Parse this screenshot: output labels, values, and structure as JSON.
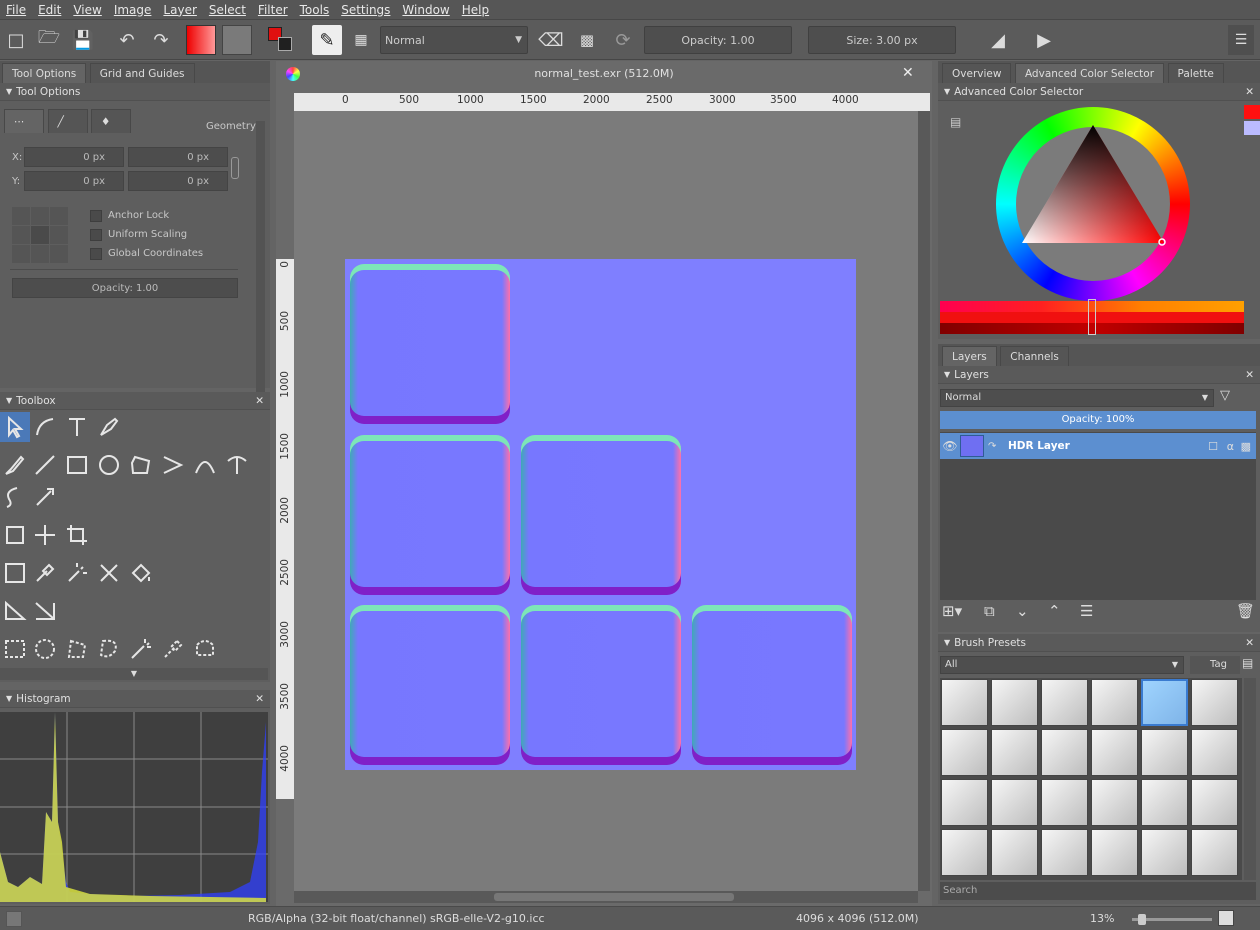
{
  "menu": [
    "File",
    "Edit",
    "View",
    "Image",
    "Layer",
    "Select",
    "Filter",
    "Tools",
    "Settings",
    "Window",
    "Help"
  ],
  "toolbar": {
    "blend_mode": "Normal",
    "opacity_label": "Opacity:",
    "opacity_value": "1.00",
    "size_label": "Size:",
    "size_value": "3.00 px",
    "fg_color": "#e01010",
    "bg_color": "#202020"
  },
  "tool_options_tabs": [
    "Tool Options",
    "Grid and Guides"
  ],
  "tool_options": {
    "title": "Tool Options",
    "geometry_label": "Geometry",
    "x_label": "X:",
    "y_label": "Y:",
    "x_value": "0 px",
    "x2_value": "0 px",
    "y_value": "0 px",
    "y2_value": "0 px",
    "anchor_lock": "Anchor Lock",
    "uniform_scaling": "Uniform Scaling",
    "global_coordinates": "Global Coordinates",
    "opacity": "Opacity: 1.00"
  },
  "toolbox": {
    "title": "Toolbox"
  },
  "histogram": {
    "title": "Histogram"
  },
  "document": {
    "title": "normal_test.exr (512.0M)",
    "ruler_h": [
      "0",
      "500",
      "1000",
      "1500",
      "2000",
      "2500",
      "3000",
      "3500",
      "4000"
    ],
    "ruler_v": [
      "0",
      "500",
      "1000",
      "1500",
      "2000",
      "2500",
      "3000",
      "3500",
      "4000"
    ],
    "canvas_color": "#7f7fff"
  },
  "right_tabs": [
    "Overview",
    "Advanced Color Selector",
    "Palette"
  ],
  "color_selector": {
    "title": "Advanced Color Selector"
  },
  "layer_tabs": [
    "Layers",
    "Channels"
  ],
  "layers": {
    "title": "Layers",
    "blend_mode": "Normal",
    "opacity": "Opacity:  100%",
    "items": [
      {
        "name": "HDR Layer"
      }
    ]
  },
  "brush_presets": {
    "title": "Brush Presets",
    "filter": "All",
    "tag_label": "Tag",
    "search_placeholder": "Search"
  },
  "status": {
    "color_info": "RGB/Alpha (32-bit float/channel)  sRGB-elle-V2-g10.icc",
    "dimensions": "4096 x 4096 (512.0M)",
    "zoom": "13%"
  }
}
